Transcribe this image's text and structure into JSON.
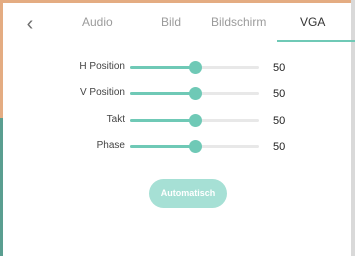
{
  "tabs": {
    "back_label": "‹",
    "audio": "Audio",
    "bild": "Bild",
    "bildschirm": "Bildschirm",
    "vga": "VGA"
  },
  "sliders": [
    {
      "label": "H Position",
      "value": "50",
      "level": 0.5
    },
    {
      "label": "V Position",
      "value": "50",
      "level": 0.5
    },
    {
      "label": "Takt",
      "value": "50",
      "level": 0.5
    },
    {
      "label": "Phase",
      "value": "50",
      "level": 0.5
    }
  ],
  "auto_button": "Automatisch",
  "colors": {
    "accent": "#6fc9b6",
    "accent_light": "#a6e0d5",
    "track": "#e8e8e8"
  },
  "icons": {
    "back": "chevron-left-icon"
  }
}
